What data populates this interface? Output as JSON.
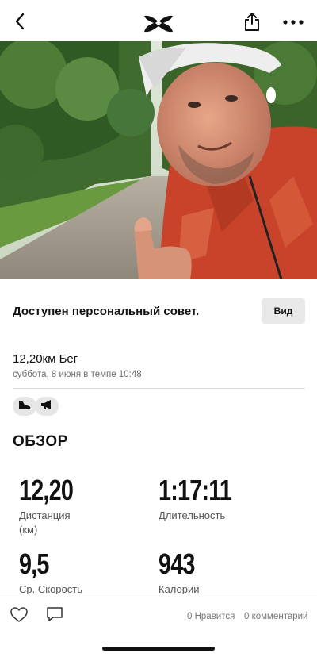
{
  "header": {
    "back_icon": "chevron-left-icon",
    "logo_icon": "under-armour-logo",
    "share_icon": "share-icon",
    "more_icon": "more-horizontal-icon"
  },
  "hero_image": "runner-selfie-thumbs-up-forest-road",
  "tip": {
    "text": "Доступен персональный совет.",
    "button_label": "Вид"
  },
  "activity": {
    "title": "12,20км Бег",
    "subtitle": "суббота, 8 июня в темпе 10:48",
    "tags": [
      "shoe-icon",
      "megaphone-icon"
    ]
  },
  "overview": {
    "title": "ОБЗОР",
    "stats": [
      {
        "value": "12,20",
        "label_line1": "Дистанция",
        "label_line2": "(км)"
      },
      {
        "value": "1:17:11",
        "label_line1": "Длительность",
        "label_line2": ""
      },
      {
        "value": "9,5",
        "label_line1": "Ср. Скорость",
        "label_line2": ""
      },
      {
        "value": "943",
        "label_line1": "Калории",
        "label_line2": ""
      }
    ]
  },
  "footer": {
    "like_icon": "heart-icon",
    "comment_icon": "comment-icon",
    "likes_text": "0 Нравится",
    "comments_text": "0 комментарий"
  },
  "colors": {
    "button_bg": "#e9e9ea",
    "shirt_red": "#c8432a",
    "muted_text": "#6e6e6e"
  }
}
